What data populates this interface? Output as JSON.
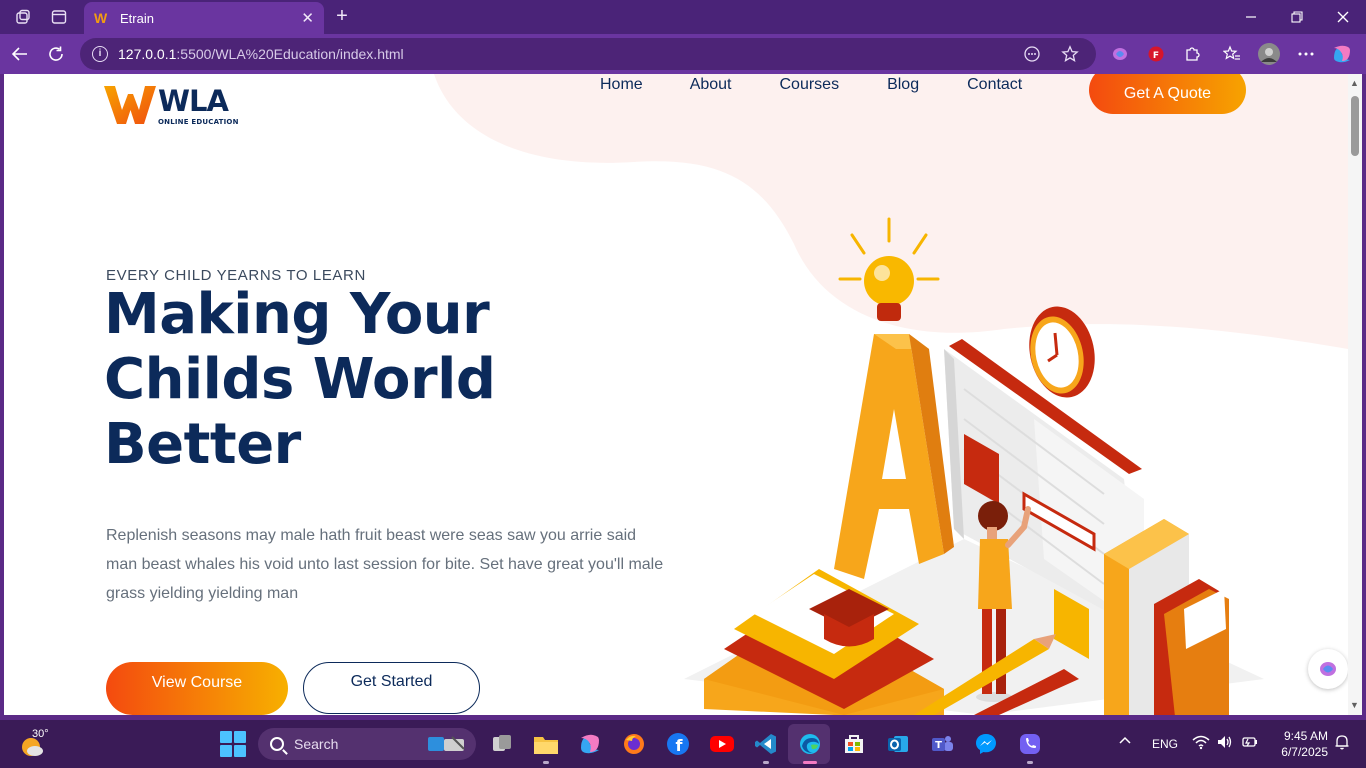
{
  "browser": {
    "tab_title": "Etrain",
    "tab_favicon": "W",
    "url_host": "127.0.0.1",
    "url_rest": ":5500/WLA%20Education/index.html"
  },
  "site": {
    "brand_name": "WLA",
    "brand_sub": "ONLINE EDUCATION",
    "nav": [
      "Home",
      "About",
      "Courses",
      "Blog",
      "Contact"
    ],
    "quote_label": "Get A Quote"
  },
  "hero": {
    "eyebrow": "EVERY CHILD YEARNS TO LEARN",
    "headline_line1": "Making Your",
    "headline_line2": "Childs World",
    "headline_line3": "Better",
    "description": "Replenish seasons may male hath fruit beast were seas saw you arrie said man beast whales his void unto last session for bite. Set have great you'll male grass yielding yielding man",
    "view_course_label": "View Course",
    "get_started_label": "Get Started"
  },
  "taskbar": {
    "temperature": "30°",
    "search_label": "Search",
    "language": "ENG",
    "time": "9:45 AM",
    "date": "6/7/2025"
  },
  "colors": {
    "brand_navy": "#0c2a5a",
    "accent_orange": "#f44a0f",
    "accent_yellow": "#f7a300",
    "browser_purple": "#6a35a0"
  }
}
